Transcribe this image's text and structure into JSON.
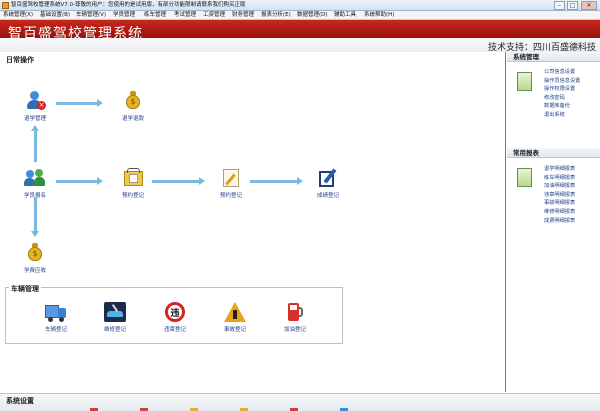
{
  "window": {
    "title": "智百盛驾校管理系统V7.0-尊敬的用户：您使用的是试用版，有部分功能限制请联系我们购买正版",
    "minimize_glyph": "–",
    "maximize_glyph": "□",
    "close_glyph": "✕"
  },
  "menu": [
    "系统管理(X)",
    "基础设置(B)",
    "车辆管理(V)",
    "学员管理",
    "练车管理",
    "考试管理",
    "工资管理",
    "财务管理",
    "报表分析(E)",
    "数据管理(D)",
    "辅助工具",
    "系统帮助(H)"
  ],
  "banner": {
    "title": "智百盛驾校管理系统",
    "support": "技术支持：四川百盛德科技"
  },
  "daily": {
    "heading": "日常操作",
    "nodes": {
      "withdraw_mgmt": "退学管理",
      "withdraw_refund": "退学退款",
      "student_register": "学员报名",
      "appointment": "预约登记",
      "practice": "预约登记",
      "score_register": "成绩登记",
      "fee_collect": "学费应收"
    }
  },
  "vehicle": {
    "heading": "车辆管理",
    "items": [
      "车辆登记",
      "维修登记",
      "违章登记",
      "事故登记",
      "加油登记"
    ]
  },
  "system": {
    "heading": "系统管理",
    "items": [
      "公司信息设置",
      "操作员信息设置",
      "操作权限设置",
      "修改密码",
      "数据库备份",
      "退出系统"
    ]
  },
  "reports": {
    "heading": "常用报表",
    "items": [
      "退学明细报表",
      "练车明细报表",
      "加油明细报表",
      "违章明细报表",
      "事故明细报表",
      "维修明细报表",
      "成费明细报表"
    ]
  },
  "bottom": {
    "heading": "系统设置"
  },
  "colors": {
    "banner": "#b01e14",
    "arrow": "#7cb9e0",
    "link": "#1f3d8a",
    "panel_border": "#4a9a4a"
  }
}
